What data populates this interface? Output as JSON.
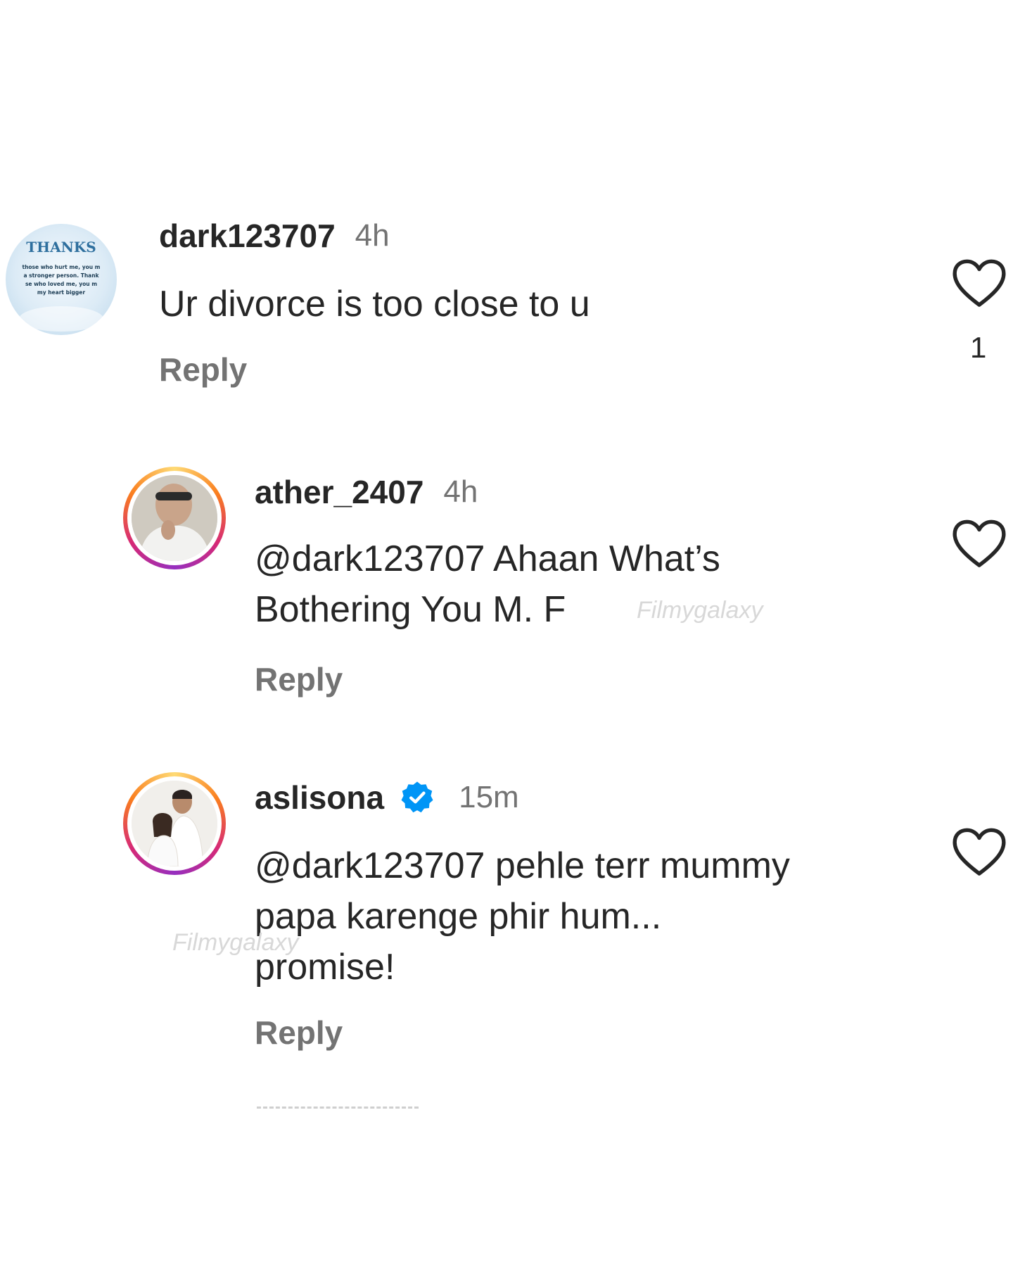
{
  "comments": [
    {
      "username": "dark123707",
      "time": "4h",
      "text": "Ur divorce is too close to u",
      "reply_label": "Reply",
      "like_count": "1",
      "avatar_text": {
        "title": "THANKS",
        "lines": [
          "those who hurt me, you m",
          "a stronger person. Thank",
          "se who loved me, you m",
          "my heart bigger"
        ]
      }
    },
    {
      "username": "ather_2407",
      "time": "4h",
      "mention": "@dark123707",
      "text_line1": " Ahaan What’s",
      "text_line2": "Bothering You M. F",
      "watermark": "Filmygalaxy",
      "reply_label": "Reply"
    },
    {
      "username": "aslisona",
      "verified": true,
      "time": "15m",
      "mention": "@dark123707",
      "text_line1": " pehle terr mummy",
      "text_line2": "papa karenge phir hum...",
      "text_line3": "promise!",
      "watermark": "Filmygalaxy",
      "reply_label": "Reply"
    }
  ],
  "colors": {
    "text": "#262626",
    "secondary": "#737373",
    "verified_blue": "#0095f6"
  },
  "icons": {
    "like": "heart-outline-icon",
    "verified": "verified-badge-icon"
  }
}
